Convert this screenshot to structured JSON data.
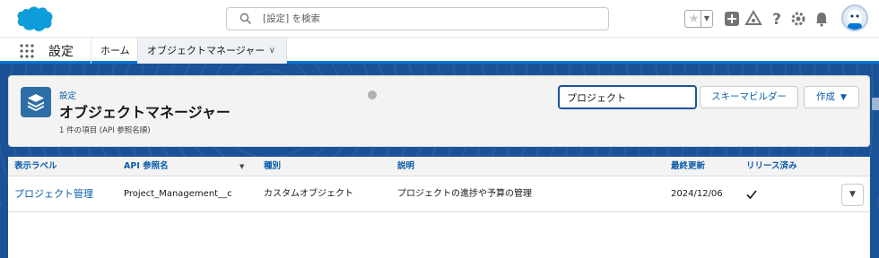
{
  "header": {
    "search_placeholder": "[設定] を検索"
  },
  "app_nav": {
    "app_name": "設定",
    "tabs": [
      {
        "label": "ホーム"
      },
      {
        "label": "オブジェクトマネージャー"
      }
    ]
  },
  "page_header": {
    "breadcrumb": "設定",
    "title": "オブジェクトマネージャー",
    "item_count": "1 件の項目 (API 参照名順)",
    "quick_find_value": "プロジェクト",
    "schema_builder_label": "スキーマビルダー",
    "create_label": "作成"
  },
  "table": {
    "columns": [
      "表示ラベル",
      "API 参照名",
      "種別",
      "説明",
      "最終更新",
      "リリース済み"
    ],
    "rows": [
      {
        "label": "プロジェクト管理",
        "api_name": "Project_Management__c",
        "type": "カスタムオブジェクト",
        "description": "プロジェクトの進捗や予算の管理",
        "last_modified": "2024/12/06",
        "deployed": true
      }
    ]
  },
  "colors": {
    "brand_blue": "#0176d3",
    "band_blue": "#1b5297",
    "link_blue": "#0b5cab"
  },
  "icons": [
    "cloud-logo",
    "search-icon",
    "star-icon",
    "add-icon",
    "trailhead-icon",
    "help-icon",
    "gear-icon",
    "bell-icon",
    "avatar",
    "waffle-icon",
    "chevron-down-icon",
    "layers-icon",
    "checkmark-icon"
  ]
}
